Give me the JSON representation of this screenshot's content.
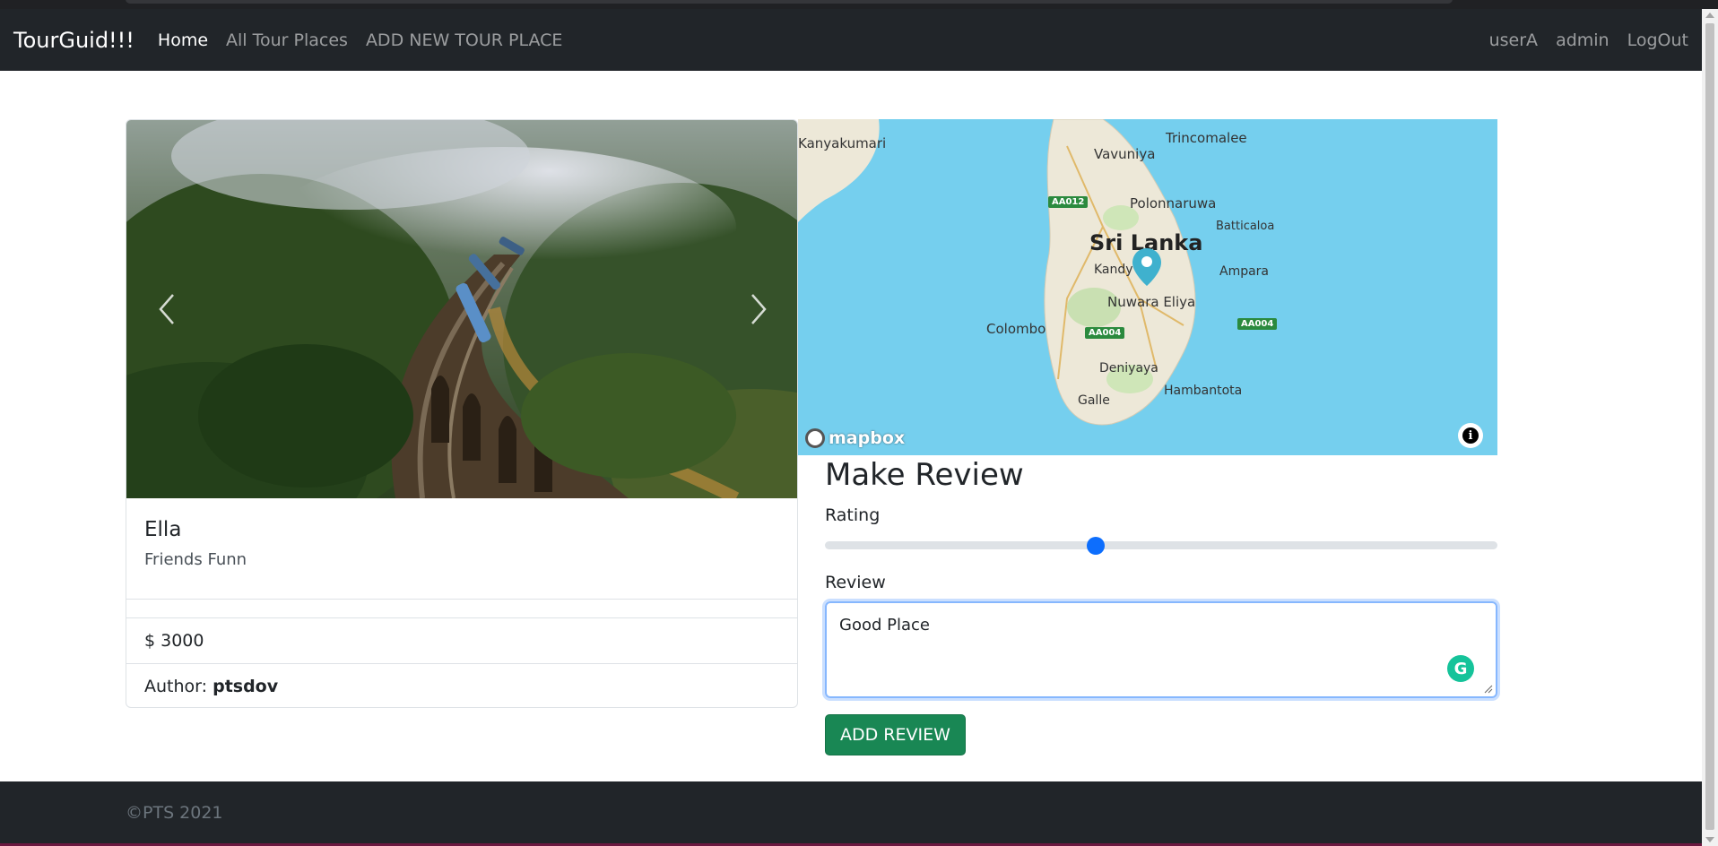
{
  "navbar": {
    "brand": "TourGuid!!!",
    "links": [
      "Home",
      "All Tour Places",
      "ADD NEW TOUR PLACE"
    ],
    "right_links": [
      "userA",
      "admin",
      "LogOut"
    ]
  },
  "card": {
    "title": "Ella",
    "description": "Friends Funn",
    "price": "$ 3000",
    "author_label": "Author:",
    "author_name": "ptsdov"
  },
  "map": {
    "country": "Sri Lanka",
    "places": [
      "Vavuniya",
      "Trincomalee",
      "Polonnaruwa",
      "Batticaloa",
      "Ampara",
      "Kandy",
      "Nuwara Eliya",
      "Colombo",
      "Deniyaya",
      "Hambantota",
      "Galle",
      "Kanyakumari"
    ],
    "roads": [
      "AA012",
      "AA004",
      "AA004"
    ],
    "attribution": "mapbox"
  },
  "review": {
    "heading": "Make Review",
    "rating_label": "Rating",
    "rating_value": 0.4,
    "review_label": "Review",
    "review_text": "Good Place",
    "submit_label": "ADD REVIEW"
  },
  "footer": {
    "copyright": "©PTS 2021"
  },
  "colors": {
    "navbar": "#212529",
    "accent_blue": "#0d6efd",
    "button_green": "#198754",
    "water": "#75cfee"
  }
}
